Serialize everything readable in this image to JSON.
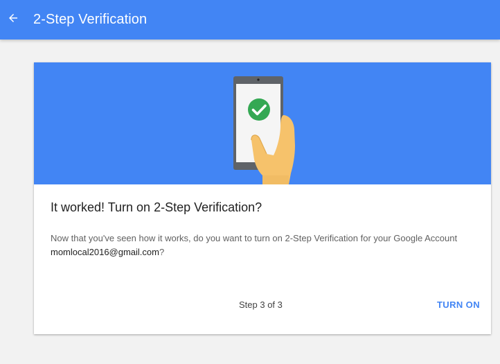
{
  "appbar": {
    "back_icon": "arrow-back-icon",
    "title": "2-Step Verification",
    "color": "#4285f4"
  },
  "card": {
    "hero_image": "phone-check-illustration",
    "title": "It worked! Turn on 2-Step Verification?",
    "body_prefix": "Now that you've seen how it works, do you want to turn on 2-Step Verification for your Google Account ",
    "email": "momlocal2016@gmail.com",
    "body_suffix": "?",
    "step": "Step 3 of 3",
    "action_label": "TURN ON"
  },
  "colors": {
    "accent": "#4285f4",
    "success": "#34a853",
    "background": "#f2f2f2"
  }
}
